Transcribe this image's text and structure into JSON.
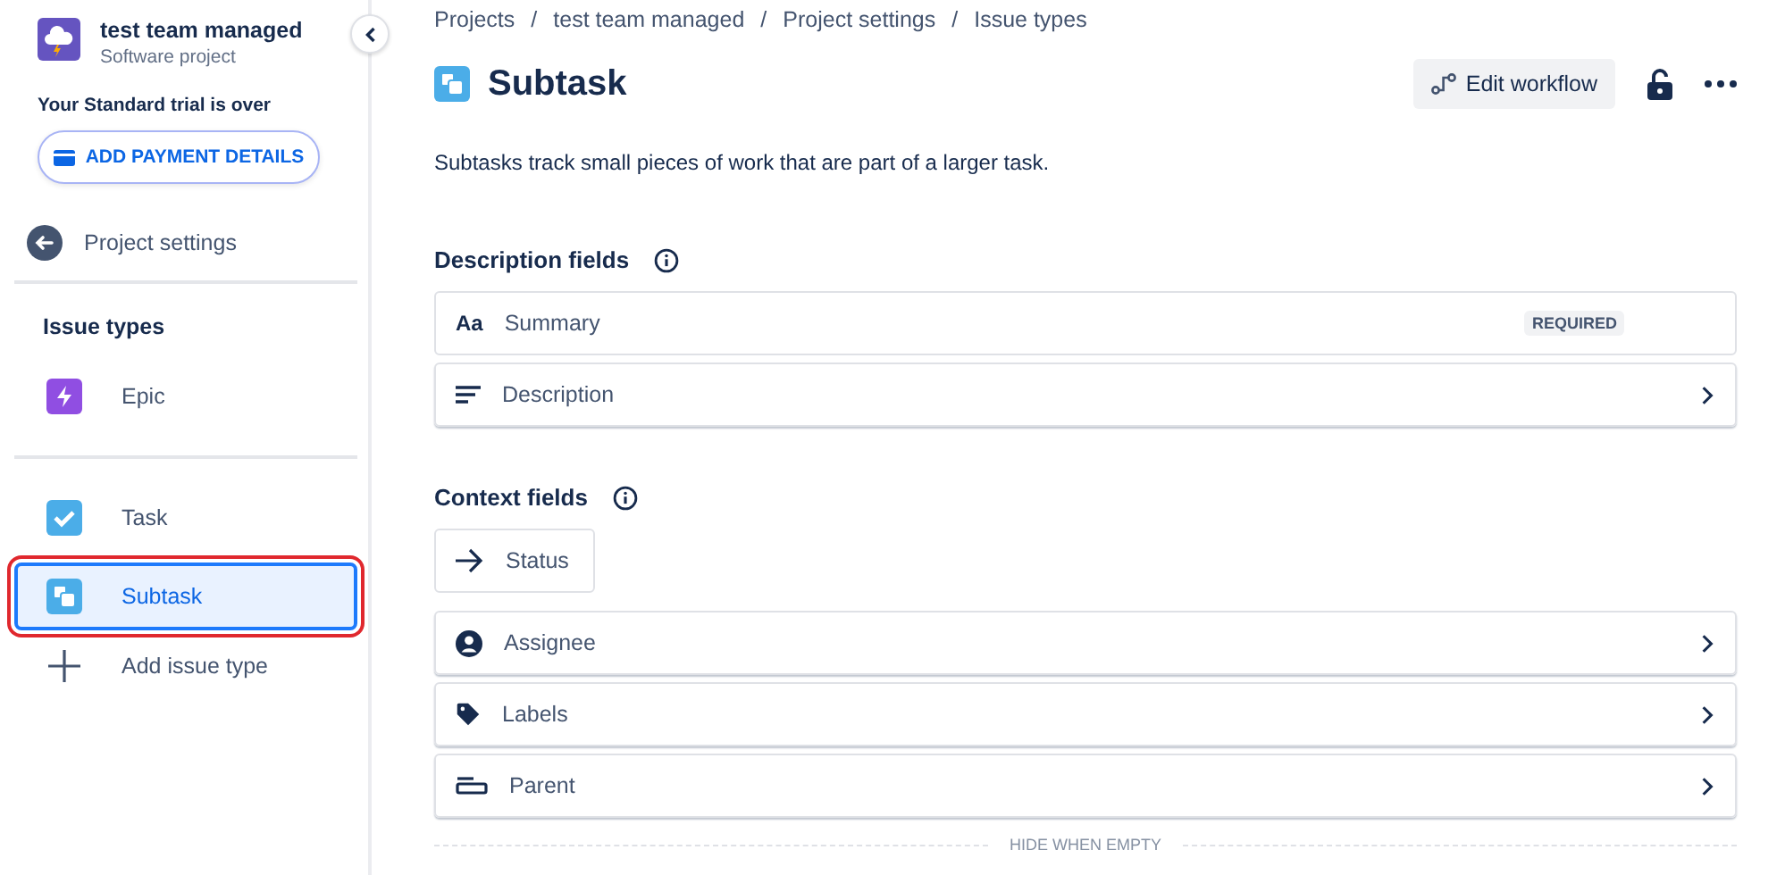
{
  "project": {
    "name": "test team managed",
    "type": "Software project"
  },
  "trial": {
    "notice": "Your Standard trial is over",
    "button": "ADD PAYMENT DETAILS"
  },
  "back_link": "Project settings",
  "sidebar": {
    "heading": "Issue types",
    "items": [
      {
        "label": "Epic",
        "kind": "epic",
        "selected": false,
        "divider_after": true
      },
      {
        "label": "Task",
        "kind": "task",
        "selected": false,
        "divider_after": false
      },
      {
        "label": "Subtask",
        "kind": "subtask",
        "selected": true,
        "divider_after": false
      }
    ],
    "add": "Add issue type"
  },
  "breadcrumbs": {
    "separator": "/",
    "items": [
      "Projects",
      "test team managed",
      "Project settings",
      "Issue types"
    ]
  },
  "title": "Subtask",
  "actions": {
    "edit_workflow": "Edit workflow"
  },
  "description": "Subtasks track small pieces of work that are part of a larger task.",
  "sections": [
    {
      "title": "Description fields",
      "fields": [
        {
          "label": "Summary",
          "kind": "text",
          "icon_text": "Aa",
          "badge": "REQUIRED",
          "expandable": false,
          "compact": false
        },
        {
          "label": "Description",
          "kind": "paragraph",
          "expandable": true,
          "compact": false
        }
      ]
    },
    {
      "title": "Context fields",
      "fields": [
        {
          "label": "Status",
          "kind": "status",
          "expandable": false,
          "compact": true
        },
        {
          "label": "Assignee",
          "kind": "user",
          "expandable": true,
          "compact": false
        },
        {
          "label": "Labels",
          "kind": "labels",
          "expandable": true,
          "compact": false
        },
        {
          "label": "Parent",
          "kind": "parent",
          "expandable": true,
          "compact": false
        }
      ]
    }
  ],
  "hide_when_empty": "HIDE WHEN EMPTY"
}
